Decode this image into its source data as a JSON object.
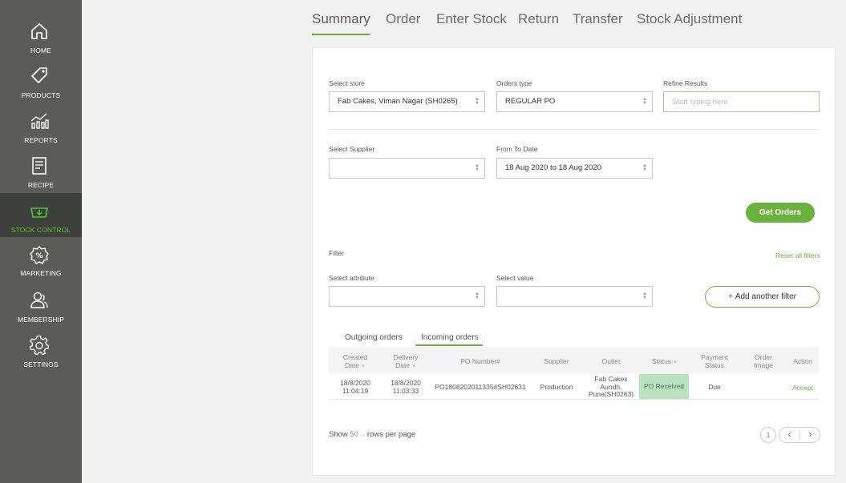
{
  "sidebar": {
    "items": [
      {
        "label": "HOME",
        "icon": "home-icon"
      },
      {
        "label": "PRODUCTS",
        "icon": "tag-icon"
      },
      {
        "label": "REPORTS",
        "icon": "reports-chart-icon"
      },
      {
        "label": "RECIPE",
        "icon": "recipe-icon"
      },
      {
        "label": "STOCK CONTROL",
        "icon": "basket-icon",
        "active": true
      },
      {
        "label": "MARKETING",
        "icon": "percent-badge-icon"
      },
      {
        "label": "MEMBERSHIP",
        "icon": "members-icon"
      },
      {
        "label": "SETTINGS",
        "icon": "gear-icon"
      }
    ],
    "colors": {
      "background": "#5b5c58",
      "active_background": "#3e403c",
      "active_text": "#56c13a"
    }
  },
  "tabs": [
    "Summary",
    "Order",
    "Enter Stock",
    "Return",
    "Transfer",
    "Stock Adjustment"
  ],
  "form": {
    "store_label": "Select store",
    "store_value": "Fab Cakes, Viman Nagar (SH0265)",
    "orders_type_label": "Orders type",
    "orders_type_value": "REGULAR PO",
    "refine_label": "Refine Results",
    "refine_placeholder": "Start typing here",
    "supplier_label": "Select Supplier",
    "supplier_value": "",
    "date_label": "From To Date",
    "date_value": "18 Aug 2020 to 18 Aug 2020",
    "get_orders": "Get Orders"
  },
  "filter": {
    "title": "Filter",
    "reset": "Reset all filters",
    "attribute_label": "Select attribute",
    "attribute_value": "",
    "value_label": "Select value",
    "value_value": "",
    "add_filter": "Add another filter"
  },
  "order_tabs": [
    "Outgoing orders",
    "Incoming orders"
  ],
  "table": {
    "headers": {
      "created": [
        "Created",
        "Date"
      ],
      "delivery": [
        "Delivery",
        "Date"
      ],
      "po": "PO Number#",
      "supplier": "Supplier",
      "outlet": "Outlet",
      "status": "Status",
      "payment": [
        "Payment",
        "Status"
      ],
      "image": [
        "Order",
        "Image"
      ],
      "action": "Action"
    },
    "rows": [
      {
        "created": [
          "18/8/2020",
          "11:04:19"
        ],
        "delivery": [
          "18/8/2020",
          "11:03:33"
        ],
        "po": "PO1808202011335#SH02631",
        "supplier": "Production",
        "outlet": [
          "Fab Cakes",
          "Aundh,",
          "Pune(SH0263)"
        ],
        "status": "PO Received",
        "payment": "Due",
        "image": "",
        "action": "Accept"
      }
    ]
  },
  "footer": {
    "show": "Show",
    "rows_value": "50",
    "rows_suffix": "rows per page",
    "page": "1"
  },
  "accent_color": "#6ab23b"
}
